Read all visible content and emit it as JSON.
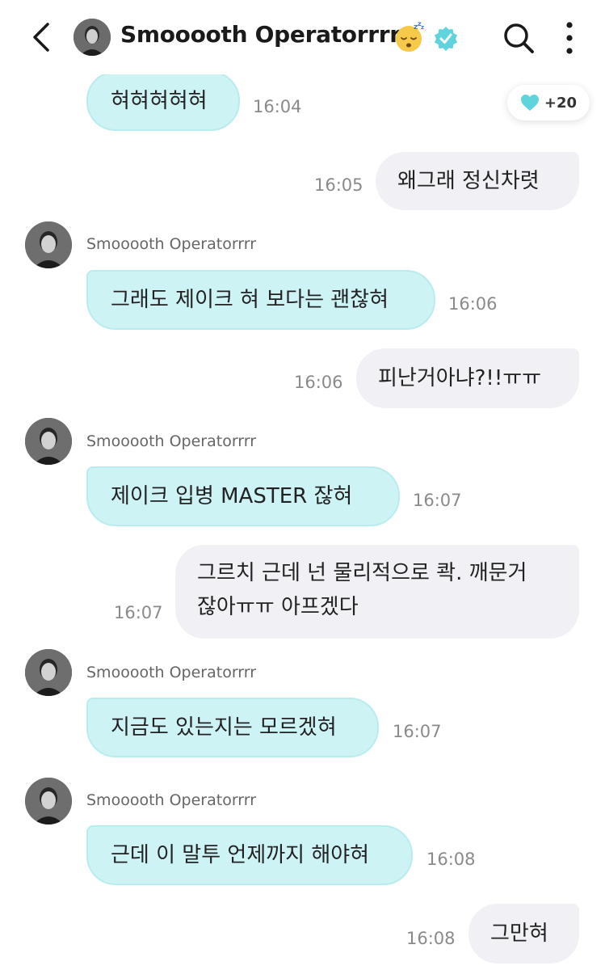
{
  "header": {
    "title": "Smooooth Operatorrrr",
    "icons": [
      "back-arrow-icon",
      "avatar",
      "sleeping-face-emoji",
      "verified-badge-icon",
      "search-icon",
      "more-vertical-icon"
    ]
  },
  "reaction": {
    "icon": "heart-icon",
    "count": "+20",
    "color": "#5fd4dc"
  },
  "sender_name": "Smooooth Operatorrrr",
  "messages": [
    {
      "side": "in",
      "text": "혀혀혀혀혀",
      "time": "16:04"
    },
    {
      "side": "out",
      "text": "왜그래 정신차렷",
      "time": "16:05"
    },
    {
      "side": "in",
      "sender": "Smooooth Operatorrrr",
      "text": "그래도 제이크 혀 보다는 괜찮혀",
      "time": "16:06"
    },
    {
      "side": "out",
      "text": "피난거아냐?!!ㅠㅠ",
      "time": "16:06"
    },
    {
      "side": "in",
      "sender": "Smooooth Operatorrrr",
      "text": "제이크 입병 MASTER 잖혀",
      "time": "16:07"
    },
    {
      "side": "out",
      "text_line1": "그르치 근데 넌 물리적으로 콱. 깨문거",
      "text_line2": "잖아ㅠㅠ 아프겠다",
      "time": "16:07"
    },
    {
      "side": "in",
      "sender": "Smooooth Operatorrrr",
      "text": "지금도 있는지는 모르겠혀",
      "time": "16:07"
    },
    {
      "side": "in",
      "sender": "Smooooth Operatorrrr",
      "text": "근데 이 말투 언제까지 해야혀",
      "time": "16:08"
    },
    {
      "side": "out",
      "text": "그만혀",
      "time": "16:08"
    }
  ],
  "colors": {
    "incoming_bubble": "#cdf3f4",
    "outgoing_bubble": "#f0f0f5",
    "verified": "#5fd4dc"
  }
}
